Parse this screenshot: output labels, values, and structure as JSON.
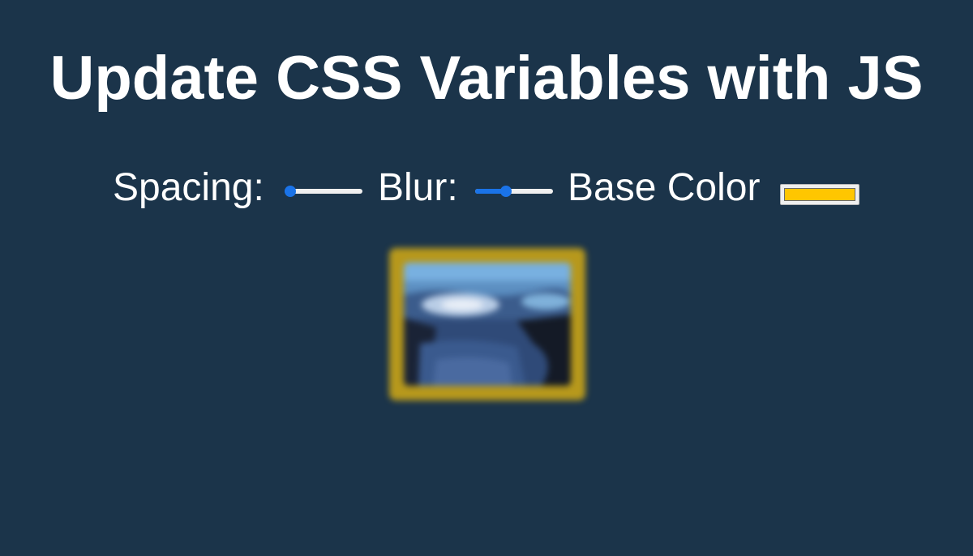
{
  "page": {
    "title": "Update CSS Variables with JS"
  },
  "controls": {
    "spacing": {
      "label": "Spacing:",
      "value": 0,
      "min": 0,
      "max": 100
    },
    "blur": {
      "label": "Blur:",
      "value": 0.4,
      "min": 0,
      "max": 1
    },
    "base_color": {
      "label": "Base Color",
      "value": "#ffc600"
    }
  },
  "colors": {
    "background": "#1b344a",
    "accent": "#1a73e8",
    "base": "#ffc600"
  },
  "image": {
    "icon": "landscape-photo"
  }
}
